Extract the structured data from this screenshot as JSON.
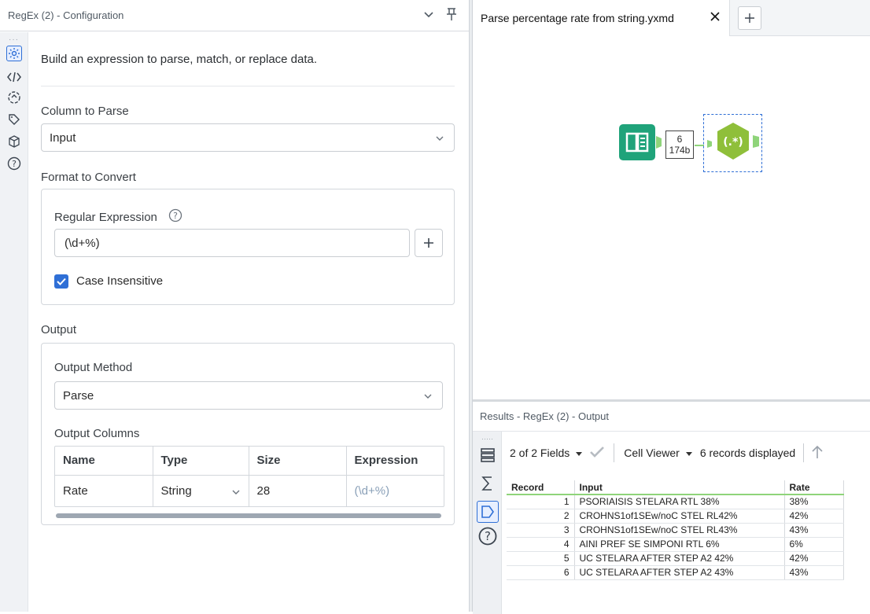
{
  "config_panel": {
    "title": "RegEx (2) - Configuration",
    "description": "Build an expression to parse, match, or replace data.",
    "column_to_parse": {
      "label": "Column to Parse",
      "value": "Input"
    },
    "format_to_convert": {
      "label": "Format to Convert",
      "regex_label": "Regular Expression",
      "regex_value": "(\\d+%)",
      "case_insensitive_label": "Case Insensitive",
      "case_insensitive_checked": true
    },
    "output": {
      "label": "Output",
      "method_label": "Output Method",
      "method_value": "Parse",
      "columns_label": "Output Columns",
      "columns_headers": [
        "Name",
        "Type",
        "Size",
        "Expression"
      ],
      "row": {
        "name": "Rate",
        "type": "String",
        "size": "28",
        "expression": "(\\d+%)"
      }
    }
  },
  "canvas": {
    "tab_title": "Parse percentage rate from string.yxmd",
    "connection_label": {
      "count": "6",
      "size": "174b"
    }
  },
  "results": {
    "title": "Results - RegEx (2) - Output",
    "toolbar": {
      "fields": "2 of 2 Fields",
      "viewer": "Cell Viewer",
      "records": "6 records displayed"
    },
    "headers": [
      "Record",
      "Input",
      "Rate"
    ],
    "rows": [
      {
        "record": "1",
        "input": "PSORIAISIS STELARA RTL 38%",
        "rate": "38%"
      },
      {
        "record": "2",
        "input": "CROHNS1of1SEw/noC STEL RL42%",
        "rate": "42%"
      },
      {
        "record": "3",
        "input": "CROHNS1of1SEw/noC STEL RL43%",
        "rate": "43%"
      },
      {
        "record": "4",
        "input": "AINI PREF SE SIMPONI RTL 6%",
        "rate": "6%"
      },
      {
        "record": "5",
        "input": "UC STELARA AFTER STEP A2 42%",
        "rate": "42%"
      },
      {
        "record": "6",
        "input": "UC STELARA AFTER STEP A2 43%",
        "rate": "43%"
      }
    ]
  },
  "colors": {
    "accent": "#2f6fd6",
    "input_tool": "#1fa37a",
    "regex_tool": "#8fbf3a"
  }
}
